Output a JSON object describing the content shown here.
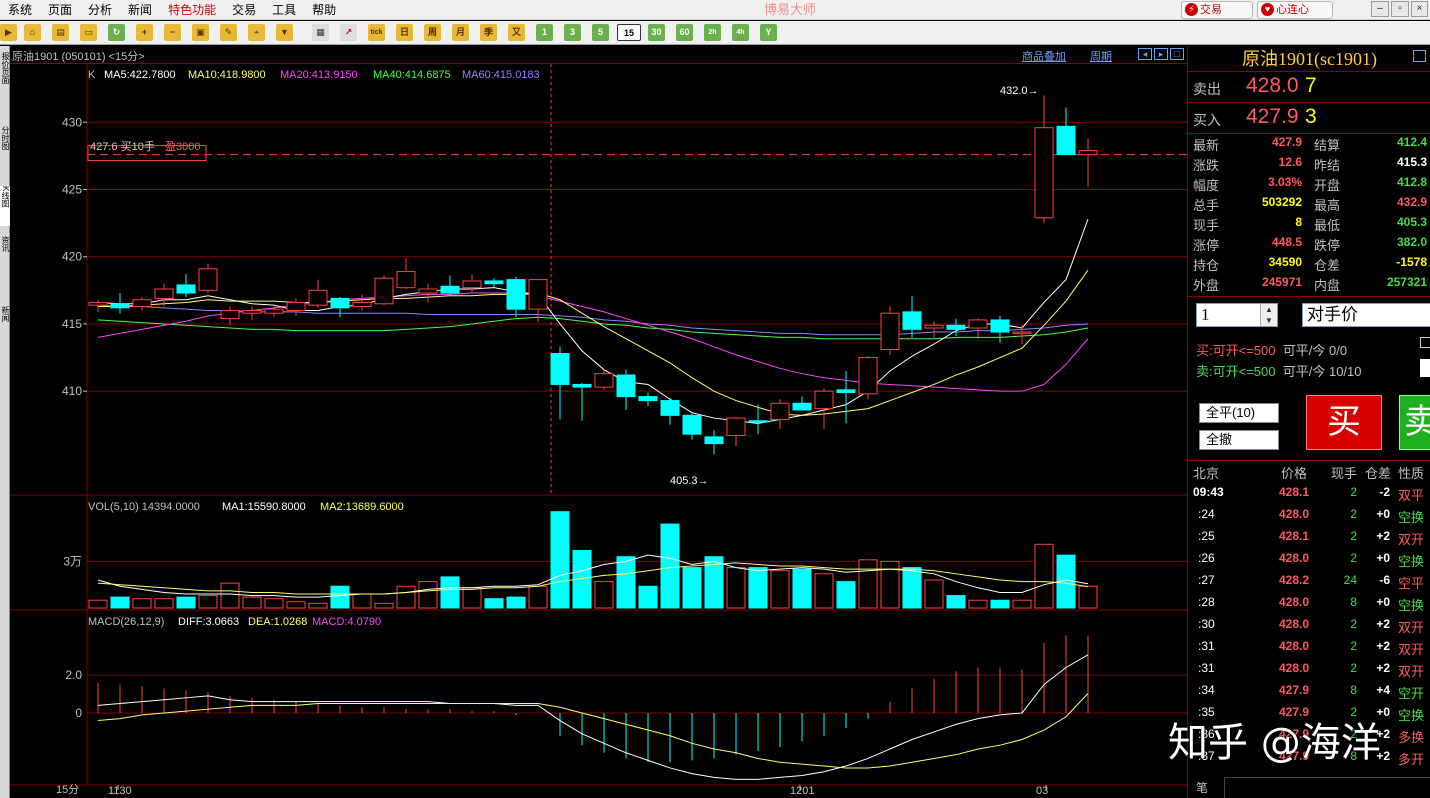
{
  "menubar": {
    "items": [
      "系统",
      "页面",
      "分析",
      "新闻",
      "特色功能",
      "交易",
      "工具",
      "帮助"
    ],
    "app_title": "博易大师",
    "trade_button": "交易",
    "connect_button": "心连心"
  },
  "toolbar": {
    "periods": [
      "tick",
      "日",
      "周",
      "月",
      "季",
      "又",
      "1",
      "3",
      "5",
      "15",
      "30",
      "60",
      "2h",
      "4h",
      "Y"
    ],
    "selected_period": "15"
  },
  "left_tabs": [
    "报价页面",
    "分时图",
    "K线图",
    "资讯",
    "新闻"
  ],
  "chart_header": {
    "name": "原油1901 (050101) <15分>",
    "link_overlay": "商品叠加",
    "link_period": "周期"
  },
  "main_chart": {
    "indicator_label": "K",
    "ma5": "MA5:422.7800",
    "ma10": "MA10:418.9800",
    "ma20": "MA20:413.9150",
    "ma40": "MA40:414.6875",
    "ma60": "MA60:415.0183",
    "ma5_color": "#ffffff",
    "ma10_color": "#ffff66",
    "ma20_color": "#ff44ff",
    "ma40_color": "#44ff44",
    "ma60_color": "#8888ff",
    "position_label": "427.6 买10手",
    "position_profit": "盈3000",
    "high_label": "432.0→",
    "low_label": "405.3→"
  },
  "vol_chart": {
    "label": "VOL(5,10) 14394.0000",
    "ma1": "MA1:15590.8000",
    "ma2": "MA2:13689.6000"
  },
  "macd_chart": {
    "label": "MACD(26,12,9)",
    "diff": "DIFF:3.0663",
    "dea": "DEA:1.0268",
    "macd": "MACD:4.0790"
  },
  "x_axis_labels": {
    "a": "1130",
    "b": "1201",
    "c": "03",
    "d": "15分"
  },
  "chart_data": {
    "type": "candlestick",
    "x_interval": "15分",
    "price_ticks": [
      430,
      425,
      420,
      415,
      410
    ],
    "ylim_price": [
      402.5,
      432.7
    ],
    "candles": [
      {
        "o": 416.4,
        "h": 416.8,
        "l": 415.9,
        "c": 416.6
      },
      {
        "o": 416.5,
        "h": 417.3,
        "l": 415.8,
        "c": 416.2
      },
      {
        "o": 416.3,
        "h": 417.0,
        "l": 416.0,
        "c": 416.8
      },
      {
        "o": 416.9,
        "h": 418.0,
        "l": 416.3,
        "c": 417.6
      },
      {
        "o": 417.9,
        "h": 418.7,
        "l": 417.0,
        "c": 417.3
      },
      {
        "o": 417.5,
        "h": 419.5,
        "l": 417.3,
        "c": 419.1
      },
      {
        "o": 415.4,
        "h": 416.3,
        "l": 414.9,
        "c": 416.0
      },
      {
        "o": 415.8,
        "h": 416.3,
        "l": 415.3,
        "c": 416.0
      },
      {
        "o": 415.8,
        "h": 416.4,
        "l": 415.5,
        "c": 416.1
      },
      {
        "o": 416.0,
        "h": 416.9,
        "l": 415.6,
        "c": 416.6
      },
      {
        "o": 416.4,
        "h": 418.3,
        "l": 416.2,
        "c": 417.5
      },
      {
        "o": 416.9,
        "h": 417.0,
        "l": 415.5,
        "c": 416.2
      },
      {
        "o": 416.3,
        "h": 417.2,
        "l": 416.0,
        "c": 416.6
      },
      {
        "o": 416.5,
        "h": 418.6,
        "l": 416.4,
        "c": 418.4
      },
      {
        "o": 417.7,
        "h": 419.9,
        "l": 417.6,
        "c": 418.9
      },
      {
        "o": 417.3,
        "h": 418.0,
        "l": 416.6,
        "c": 417.6
      },
      {
        "o": 417.8,
        "h": 418.6,
        "l": 417.2,
        "c": 417.3
      },
      {
        "o": 417.7,
        "h": 418.7,
        "l": 417.3,
        "c": 418.2
      },
      {
        "o": 418.2,
        "h": 418.4,
        "l": 417.7,
        "c": 418.0
      },
      {
        "o": 418.3,
        "h": 418.5,
        "l": 415.5,
        "c": 416.1
      },
      {
        "o": 416.1,
        "h": 418.1,
        "l": 415.1,
        "c": 418.3
      },
      {
        "o": 412.8,
        "h": 413.3,
        "l": 407.9,
        "c": 410.5
      },
      {
        "o": 410.5,
        "h": 410.6,
        "l": 407.8,
        "c": 410.3
      },
      {
        "o": 410.3,
        "h": 411.6,
        "l": 410.1,
        "c": 411.3
      },
      {
        "o": 411.2,
        "h": 411.6,
        "l": 408.6,
        "c": 409.6
      },
      {
        "o": 409.6,
        "h": 409.9,
        "l": 408.9,
        "c": 409.3
      },
      {
        "o": 409.3,
        "h": 409.5,
        "l": 407.5,
        "c": 408.2
      },
      {
        "o": 408.2,
        "h": 408.4,
        "l": 406.4,
        "c": 406.8
      },
      {
        "o": 406.6,
        "h": 407.1,
        "l": 405.3,
        "c": 406.1
      },
      {
        "o": 406.7,
        "h": 408.1,
        "l": 405.9,
        "c": 408.0
      },
      {
        "o": 407.8,
        "h": 409.0,
        "l": 406.8,
        "c": 407.7
      },
      {
        "o": 407.9,
        "h": 409.4,
        "l": 407.2,
        "c": 409.1
      },
      {
        "o": 409.1,
        "h": 409.6,
        "l": 408.6,
        "c": 408.6
      },
      {
        "o": 408.7,
        "h": 410.2,
        "l": 407.2,
        "c": 410.0
      },
      {
        "o": 410.1,
        "h": 411.5,
        "l": 407.6,
        "c": 409.9
      },
      {
        "o": 409.8,
        "h": 412.6,
        "l": 409.4,
        "c": 412.5
      },
      {
        "o": 413.1,
        "h": 416.3,
        "l": 412.7,
        "c": 415.8
      },
      {
        "o": 415.9,
        "h": 417.1,
        "l": 414.0,
        "c": 414.6
      },
      {
        "o": 414.7,
        "h": 415.2,
        "l": 413.9,
        "c": 414.9
      },
      {
        "o": 414.9,
        "h": 415.4,
        "l": 414.1,
        "c": 414.6
      },
      {
        "o": 414.7,
        "h": 415.4,
        "l": 413.9,
        "c": 415.3
      },
      {
        "o": 415.3,
        "h": 415.6,
        "l": 413.6,
        "c": 414.4
      },
      {
        "o": 414.3,
        "h": 414.9,
        "l": 413.5,
        "c": 414.4
      },
      {
        "o": 422.9,
        "h": 432.0,
        "l": 422.5,
        "c": 429.6
      },
      {
        "o": 429.7,
        "h": 431.1,
        "l": 427.6,
        "c": 427.6
      },
      {
        "o": 427.6,
        "h": 428.8,
        "l": 425.2,
        "c": 427.9
      }
    ],
    "ma5": [
      416.6,
      416.5,
      416.5,
      416.8,
      416.8,
      417.1,
      416.8,
      416.5,
      416.4,
      416.0,
      416.0,
      416.3,
      416.4,
      416.9,
      417.2,
      417.4,
      417.6,
      417.6,
      417.7,
      417.4,
      417.2,
      415.0,
      413.0,
      411.6,
      410.7,
      410.5,
      409.4,
      408.4,
      408.0,
      407.8,
      407.6,
      407.9,
      408.2,
      408.6,
      409.0,
      410.0,
      411.5,
      412.6,
      413.5,
      414.5,
      415.0,
      415.0,
      414.7,
      416.6,
      418.3,
      422.8
    ],
    "ma10": [
      416.3,
      416.3,
      416.4,
      416.5,
      416.6,
      416.8,
      416.7,
      416.7,
      416.7,
      416.6,
      416.6,
      416.7,
      416.8,
      416.9,
      416.9,
      417.0,
      417.1,
      417.1,
      417.2,
      417.2,
      417.3,
      416.8,
      415.8,
      414.8,
      413.9,
      413.0,
      412.1,
      411.0,
      410.0,
      409.3,
      408.8,
      408.3,
      408.2,
      408.3,
      408.5,
      408.7,
      409.3,
      409.9,
      410.5,
      411.2,
      411.8,
      412.5,
      413.2,
      414.9,
      416.7,
      419.0
    ],
    "ma20": [
      414.0,
      414.3,
      414.6,
      414.9,
      415.2,
      415.6,
      415.8,
      416.0,
      416.2,
      416.4,
      416.6,
      416.8,
      416.9,
      417.0,
      417.1,
      417.2,
      417.2,
      417.3,
      417.3,
      417.3,
      417.1,
      416.7,
      416.3,
      415.9,
      415.4,
      414.9,
      414.4,
      413.9,
      413.3,
      412.7,
      412.2,
      411.7,
      411.3,
      411.0,
      410.8,
      410.6,
      410.5,
      410.4,
      410.3,
      410.2,
      410.1,
      410.0,
      410.0,
      410.5,
      412.0,
      413.9
    ],
    "ma40": [
      415.3,
      415.2,
      415.1,
      415.0,
      414.9,
      414.8,
      414.7,
      414.6,
      414.6,
      414.5,
      414.5,
      414.5,
      414.5,
      414.5,
      414.6,
      414.7,
      414.8,
      415.0,
      415.2,
      415.4,
      415.5,
      415.4,
      415.2,
      415.0,
      414.9,
      414.7,
      414.6,
      414.4,
      414.3,
      414.2,
      414.1,
      414.0,
      414.0,
      413.9,
      413.9,
      413.9,
      413.9,
      413.9,
      413.9,
      414.0,
      414.0,
      414.0,
      414.1,
      414.2,
      414.4,
      414.7
    ],
    "ma60": [
      416.4,
      416.3,
      416.3,
      416.2,
      416.1,
      416.0,
      416.0,
      415.9,
      415.9,
      415.9,
      415.8,
      415.8,
      415.8,
      415.8,
      415.8,
      415.7,
      415.7,
      415.7,
      415.7,
      415.7,
      415.7,
      415.6,
      415.5,
      415.3,
      415.2,
      415.0,
      414.9,
      414.7,
      414.6,
      414.5,
      414.4,
      414.3,
      414.3,
      414.2,
      414.2,
      414.2,
      414.2,
      414.3,
      414.4,
      414.4,
      414.5,
      414.5,
      414.6,
      414.7,
      414.9,
      415.0
    ],
    "volume_ticks": [
      "3万"
    ],
    "volume": [
      5000,
      7000,
      6000,
      6000,
      7000,
      8000,
      16000,
      7000,
      6000,
      4000,
      3000,
      14000,
      9000,
      3000,
      14000,
      17000,
      20000,
      13000,
      6000,
      7000,
      14000,
      62000,
      37000,
      17000,
      33000,
      14000,
      54000,
      26000,
      33000,
      26000,
      26000,
      24000,
      25000,
      22000,
      17000,
      31000,
      30000,
      26000,
      18000,
      8000,
      5000,
      5000,
      5000,
      41000,
      34000,
      14000
    ],
    "vol_ma1": [
      18000,
      14000,
      12000,
      10000,
      9000,
      9000,
      9000,
      8000,
      8000,
      7000,
      7000,
      8000,
      9000,
      9000,
      10000,
      12000,
      13000,
      13000,
      14000,
      14000,
      15000,
      21000,
      24000,
      28000,
      30000,
      34000,
      32000,
      28000,
      30000,
      26000,
      24000,
      25000,
      26000,
      25000,
      23000,
      24000,
      25000,
      24000,
      22000,
      17000,
      13000,
      10000,
      10000,
      15000,
      18000,
      15590
    ],
    "vol_ma2": [
      16000,
      15000,
      14000,
      13000,
      12000,
      11000,
      11000,
      10000,
      10000,
      9000,
      9000,
      9000,
      9000,
      9000,
      10000,
      11000,
      12000,
      12000,
      13000,
      13000,
      14000,
      17000,
      19000,
      21000,
      22000,
      24000,
      26000,
      27000,
      28000,
      29000,
      28000,
      27000,
      27000,
      26000,
      25000,
      25000,
      25000,
      25000,
      24000,
      22000,
      20000,
      18000,
      17000,
      17000,
      16000,
      13689
    ],
    "macd_ticks": [
      2.0,
      0
    ],
    "ylim_macd": [
      -3.8,
      4.8
    ],
    "macd_hist": [
      1.6,
      1.5,
      1.4,
      1.3,
      1.2,
      1.1,
      0.9,
      0.8,
      0.7,
      0.6,
      0.5,
      0.4,
      0.3,
      0.3,
      0.2,
      0.2,
      0.2,
      0.1,
      0.1,
      -0.1,
      0.0,
      -1.2,
      -1.7,
      -2.1,
      -2.4,
      -2.6,
      -2.6,
      -2.5,
      -2.4,
      -2.2,
      -2.0,
      -1.8,
      -1.5,
      -1.2,
      -0.8,
      -0.3,
      0.6,
      1.3,
      1.8,
      2.2,
      2.4,
      2.4,
      2.3,
      3.7,
      4.1,
      4.079
    ],
    "diff": [
      0.4,
      0.5,
      0.6,
      0.7,
      0.8,
      0.9,
      0.7,
      0.6,
      0.6,
      0.6,
      0.6,
      0.6,
      0.6,
      0.6,
      0.6,
      0.6,
      0.5,
      0.5,
      0.5,
      0.4,
      0.4,
      -0.4,
      -1.1,
      -1.6,
      -2.1,
      -2.5,
      -2.9,
      -3.2,
      -3.4,
      -3.5,
      -3.5,
      -3.4,
      -3.3,
      -3.1,
      -2.8,
      -2.4,
      -1.9,
      -1.4,
      -1.0,
      -0.6,
      -0.3,
      -0.1,
      0.0,
      1.5,
      2.4,
      3.0663
    ],
    "dea": [
      -0.4,
      -0.3,
      -0.1,
      0.0,
      0.1,
      0.2,
      0.3,
      0.4,
      0.4,
      0.4,
      0.5,
      0.5,
      0.5,
      0.5,
      0.5,
      0.5,
      0.5,
      0.5,
      0.5,
      0.5,
      0.5,
      0.3,
      0.0,
      -0.3,
      -0.6,
      -0.9,
      -1.2,
      -1.6,
      -1.9,
      -2.1,
      -2.4,
      -2.6,
      -2.7,
      -2.8,
      -2.9,
      -2.9,
      -2.8,
      -2.6,
      -2.4,
      -2.2,
      -1.9,
      -1.7,
      -1.4,
      -0.9,
      -0.2,
      1.0268
    ],
    "current_price_line": 427.6
  },
  "right_panel": {
    "title": "原油1901(sc1901)",
    "ask_label": "卖出",
    "ask_price": "428.0",
    "ask_vol": "7",
    "bid_label": "买入",
    "bid_price": "427.9",
    "bid_vol": "3",
    "stats": [
      {
        "l1": "最新",
        "v1": "427.9",
        "c1": "red",
        "l2": "结算",
        "v2": "412.4",
        "c2": "green"
      },
      {
        "l1": "涨跌",
        "v1": "12.6",
        "c1": "red",
        "l2": "昨结",
        "v2": "415.3",
        "c2": "white"
      },
      {
        "l1": "幅度",
        "v1": "3.03%",
        "c1": "red",
        "l2": "开盘",
        "v2": "412.8",
        "c2": "green"
      },
      {
        "l1": "总手",
        "v1": "503292",
        "c1": "yellow",
        "l2": "最高",
        "v2": "432.9",
        "c2": "red"
      },
      {
        "l1": "现手",
        "v1": "8",
        "c1": "yellow",
        "l2": "最低",
        "v2": "405.3",
        "c2": "green"
      },
      {
        "l1": "涨停",
        "v1": "448.5",
        "c1": "red",
        "l2": "跌停",
        "v2": "382.0",
        "c2": "green"
      },
      {
        "l1": "持仓",
        "v1": "34590",
        "c1": "yellow",
        "l2": "仓差",
        "v2": "-1578",
        "c2": "yellow"
      },
      {
        "l1": "外盘",
        "v1": "245971",
        "c1": "red",
        "l2": "内盘",
        "v2": "257321",
        "c2": "green"
      }
    ],
    "trade": {
      "qty": "1",
      "price_type": "对手价",
      "buy_line_a": "买",
      "buy_line_b": ":可开<=500",
      "buy_line_c": "可平/今 0/0",
      "sell_line_a": "卖",
      "sell_line_b": ":可开<=500",
      "sell_line_c": "可平/今 10/10",
      "close_all": "全平(10)",
      "cancel_all": "全撤",
      "buy": "买",
      "sell": "卖"
    },
    "ticks_header": {
      "time": "北京",
      "price": "价格",
      "vol": "现手",
      "oi": "仓差",
      "nature": "性质"
    },
    "ticks": [
      {
        "t": "09:43",
        "p": "428.1",
        "v": "2",
        "d": "-2",
        "n": "双平",
        "pc": "red",
        "nc": "red"
      },
      {
        "t": ":24",
        "p": "428.0",
        "v": "2",
        "d": "+0",
        "n": "空换",
        "pc": "red",
        "nc": "green"
      },
      {
        "t": ":25",
        "p": "428.1",
        "v": "2",
        "d": "+2",
        "n": "双开",
        "pc": "red",
        "nc": "red"
      },
      {
        "t": ":26",
        "p": "428.0",
        "v": "2",
        "d": "+0",
        "n": "空换",
        "pc": "red",
        "nc": "green"
      },
      {
        "t": ":27",
        "p": "428.2",
        "v": "24",
        "d": "-6",
        "n": "空平",
        "pc": "red",
        "nc": "red"
      },
      {
        "t": ":28",
        "p": "428.0",
        "v": "8",
        "d": "+0",
        "n": "空换",
        "pc": "red",
        "nc": "green"
      },
      {
        "t": ":30",
        "p": "428.0",
        "v": "2",
        "d": "+2",
        "n": "双开",
        "pc": "red",
        "nc": "red"
      },
      {
        "t": ":31",
        "p": "428.0",
        "v": "2",
        "d": "+2",
        "n": "双开",
        "pc": "red",
        "nc": "red"
      },
      {
        "t": ":31",
        "p": "428.0",
        "v": "2",
        "d": "+2",
        "n": "双开",
        "pc": "red",
        "nc": "red"
      },
      {
        "t": ":34",
        "p": "427.9",
        "v": "8",
        "d": "+4",
        "n": "空开",
        "pc": "red",
        "nc": "green"
      },
      {
        "t": ":35",
        "p": "427.9",
        "v": "2",
        "d": "+0",
        "n": "空换",
        "pc": "red",
        "nc": "green"
      },
      {
        "t": ":36",
        "p": "427.9",
        "v": "2",
        "d": "+2",
        "n": "多换",
        "pc": "red",
        "nc": "red"
      },
      {
        "t": ":37",
        "p": "427.9",
        "v": "8",
        "d": "+2",
        "n": "多开",
        "pc": "red",
        "nc": "red"
      }
    ],
    "bottom_label": "笔"
  },
  "watermark": "知乎 @海洋",
  "colors": {
    "up": "#ff4040",
    "down": "#00ffff",
    "grid": "#800000",
    "bg": "#000000"
  }
}
